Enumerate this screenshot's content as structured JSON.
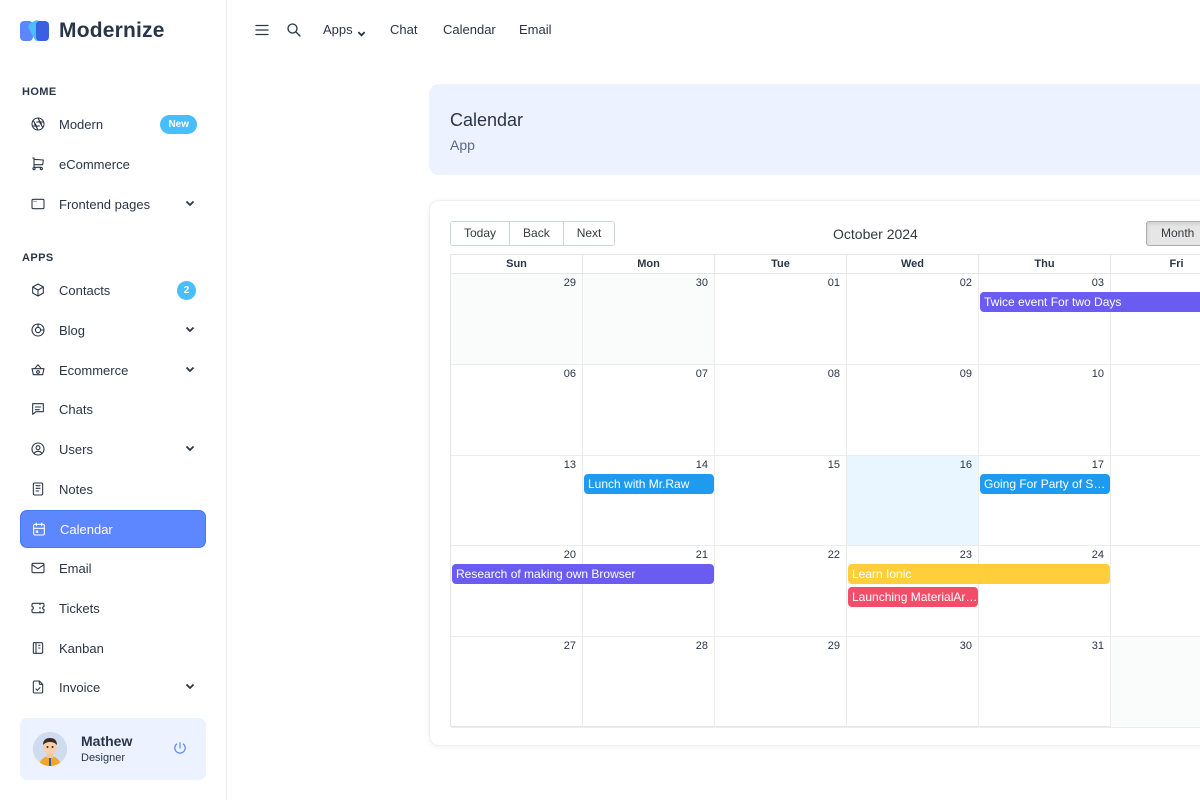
{
  "brand": {
    "name": "Modernize"
  },
  "sidebar": {
    "sections": {
      "home": "HOME",
      "apps": "APPS"
    },
    "home_items": [
      {
        "label": "Modern",
        "icon": "aperture-icon",
        "badge": "New"
      },
      {
        "label": "eCommerce",
        "icon": "shopping-cart-icon"
      },
      {
        "label": "Frontend pages",
        "icon": "app-window-icon",
        "chevron": true
      }
    ],
    "app_items": [
      {
        "label": "Contacts",
        "icon": "box-icon",
        "badge": "2"
      },
      {
        "label": "Blog",
        "icon": "chart-donut-icon",
        "chevron": true
      },
      {
        "label": "Ecommerce",
        "icon": "basket-icon",
        "chevron": true
      },
      {
        "label": "Chats",
        "icon": "message-icon"
      },
      {
        "label": "Users",
        "icon": "user-circle-icon",
        "chevron": true
      },
      {
        "label": "Notes",
        "icon": "notes-icon"
      },
      {
        "label": "Calendar",
        "icon": "calendar-icon",
        "active": true
      },
      {
        "label": "Email",
        "icon": "mail-icon"
      },
      {
        "label": "Tickets",
        "icon": "ticket-icon"
      },
      {
        "label": "Kanban",
        "icon": "notebook-icon"
      },
      {
        "label": "Invoice",
        "icon": "file-check-icon",
        "chevron": true
      }
    ],
    "profile": {
      "name": "Mathew",
      "role": "Designer"
    }
  },
  "topbar": {
    "links": [
      "Apps",
      "Chat",
      "Calendar",
      "Email"
    ]
  },
  "page": {
    "title": "Calendar",
    "subtitle": "App"
  },
  "calendar": {
    "toolbar": {
      "today": "Today",
      "back": "Back",
      "next": "Next",
      "label": "October 2024",
      "view": "Month"
    },
    "weekdays": [
      "Sun",
      "Mon",
      "Tue",
      "Wed",
      "Thu",
      "Fri"
    ],
    "weeks": [
      [
        "29",
        "30",
        "01",
        "02",
        "03",
        ""
      ],
      [
        "06",
        "07",
        "08",
        "09",
        "10",
        ""
      ],
      [
        "13",
        "14",
        "15",
        "16",
        "17",
        ""
      ],
      [
        "20",
        "21",
        "22",
        "23",
        "24",
        ""
      ],
      [
        "27",
        "28",
        "29",
        "30",
        "31",
        ""
      ]
    ],
    "events": [
      {
        "title": "Twice event For two Days",
        "color": "#6a5cf0"
      },
      {
        "title": "Lunch with Mr.Raw",
        "color": "#1e9bef"
      },
      {
        "title": "Going For Party of Sahar",
        "color": "#1e9bef"
      },
      {
        "title": "Research of making own Browser",
        "color": "#6a5cf0"
      },
      {
        "title": "Learn Ionic",
        "color": "#ffcf3b"
      },
      {
        "title": "Launching MaterialArt Angular",
        "color": "#f44d6a"
      }
    ]
  },
  "colors": {
    "primary": "#5d87ff",
    "light_primary": "#ecf2ff",
    "info": "#49beff"
  }
}
